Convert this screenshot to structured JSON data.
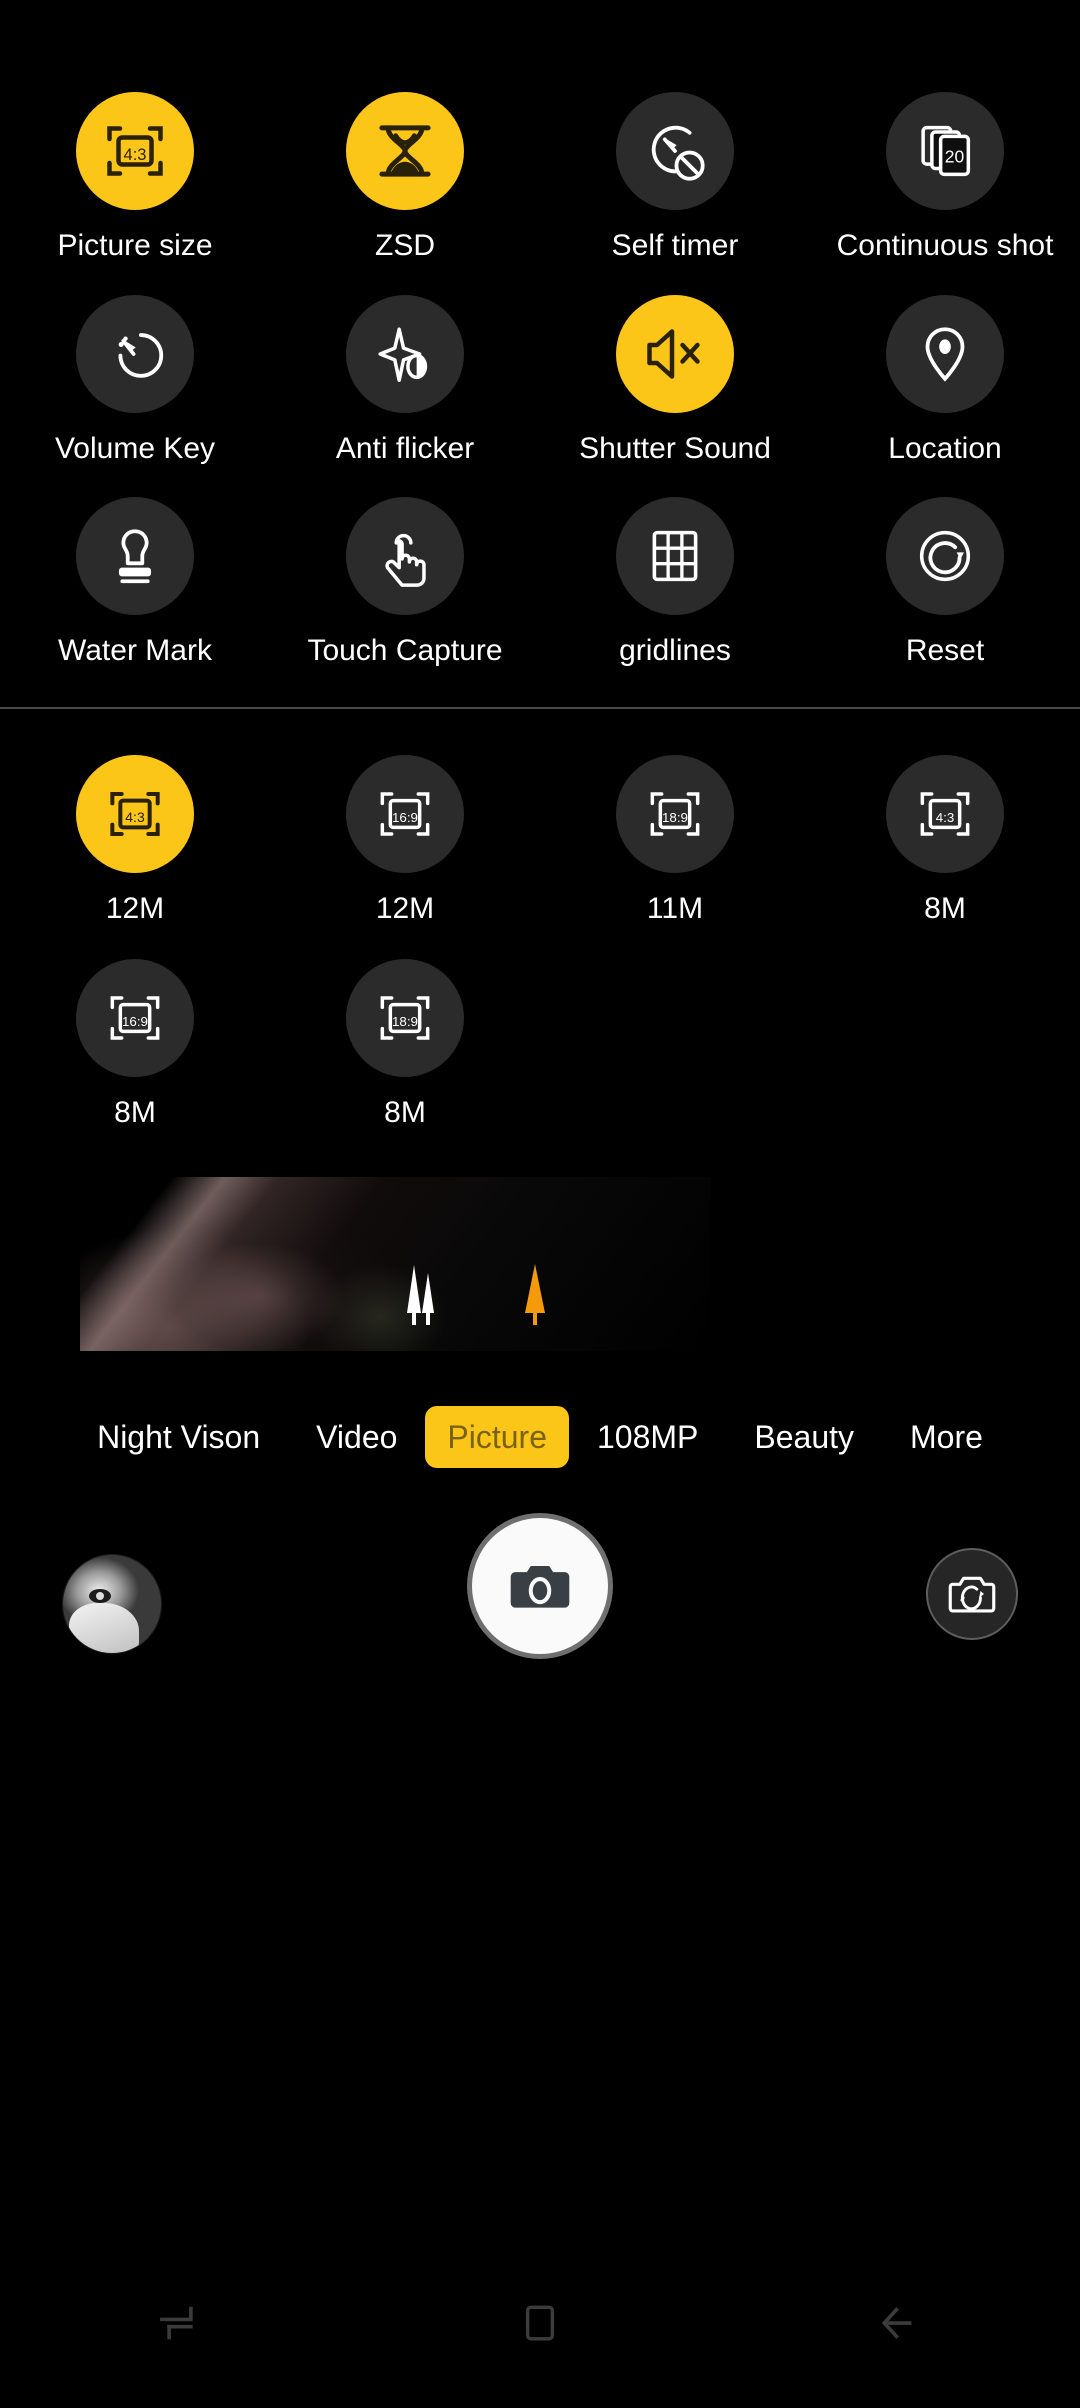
{
  "app": {
    "name": "Camera",
    "screen": "camera-settings-overlay",
    "accent_color": "#fcc618",
    "background_color": "#000000",
    "chip_color": "#2b2b2b",
    "text_color": "#ffffff"
  },
  "settings": {
    "items": [
      {
        "label": "Picture size",
        "icon": "aspect-ratio-frame-icon",
        "badge": "4:3",
        "active": true
      },
      {
        "label": "ZSD",
        "icon": "hourglass-icon",
        "badge": "",
        "active": true
      },
      {
        "label": "Self timer",
        "icon": "timer-off-icon",
        "badge": "",
        "active": false
      },
      {
        "label": "Continuous shot",
        "icon": "burst-stack-icon",
        "badge": "20",
        "active": false
      },
      {
        "label": "Volume Key",
        "icon": "volume-dial-icon",
        "badge": "",
        "active": false
      },
      {
        "label": "Anti flicker",
        "icon": "sparkle-contrast-icon",
        "badge": "",
        "active": false
      },
      {
        "label": "Shutter Sound",
        "icon": "speaker-mute-icon",
        "badge": "",
        "active": true
      },
      {
        "label": "Location",
        "icon": "location-pin-icon",
        "badge": "",
        "active": false
      },
      {
        "label": "Water Mark",
        "icon": "stamp-icon",
        "badge": "",
        "active": false
      },
      {
        "label": "Touch Capture",
        "icon": "touch-hand-icon",
        "badge": "",
        "active": false
      },
      {
        "label": "gridlines",
        "icon": "grid-icon",
        "badge": "",
        "active": false
      },
      {
        "label": "Reset",
        "icon": "reset-circular-arrow-icon",
        "badge": "",
        "active": false
      }
    ]
  },
  "picture_sizes": {
    "options": [
      {
        "megapixels": "12M",
        "ratio": "4:3",
        "selected": true
      },
      {
        "megapixels": "12M",
        "ratio": "16:9",
        "selected": false
      },
      {
        "megapixels": "11M",
        "ratio": "18:9",
        "selected": false
      },
      {
        "megapixels": "8M",
        "ratio": "4:3",
        "selected": false
      },
      {
        "megapixels": "8M",
        "ratio": "16:9",
        "selected": false
      },
      {
        "megapixels": "8M",
        "ratio": "18:9",
        "selected": false
      }
    ]
  },
  "modes": {
    "items": [
      {
        "label": "Night Vison",
        "selected": false
      },
      {
        "label": "Video",
        "selected": false
      },
      {
        "label": "Picture",
        "selected": true
      },
      {
        "label": "108MP",
        "selected": false
      },
      {
        "label": "Beauty",
        "selected": false
      },
      {
        "label": "More",
        "selected": false
      }
    ]
  },
  "bottom_controls": {
    "gallery_thumbnail": "gallery-thumbnail",
    "shutter": "shutter-button",
    "switch_camera": "switch-camera-button"
  },
  "navigation": {
    "recents": "recent-apps-icon",
    "home": "home-icon",
    "back": "back-icon"
  }
}
